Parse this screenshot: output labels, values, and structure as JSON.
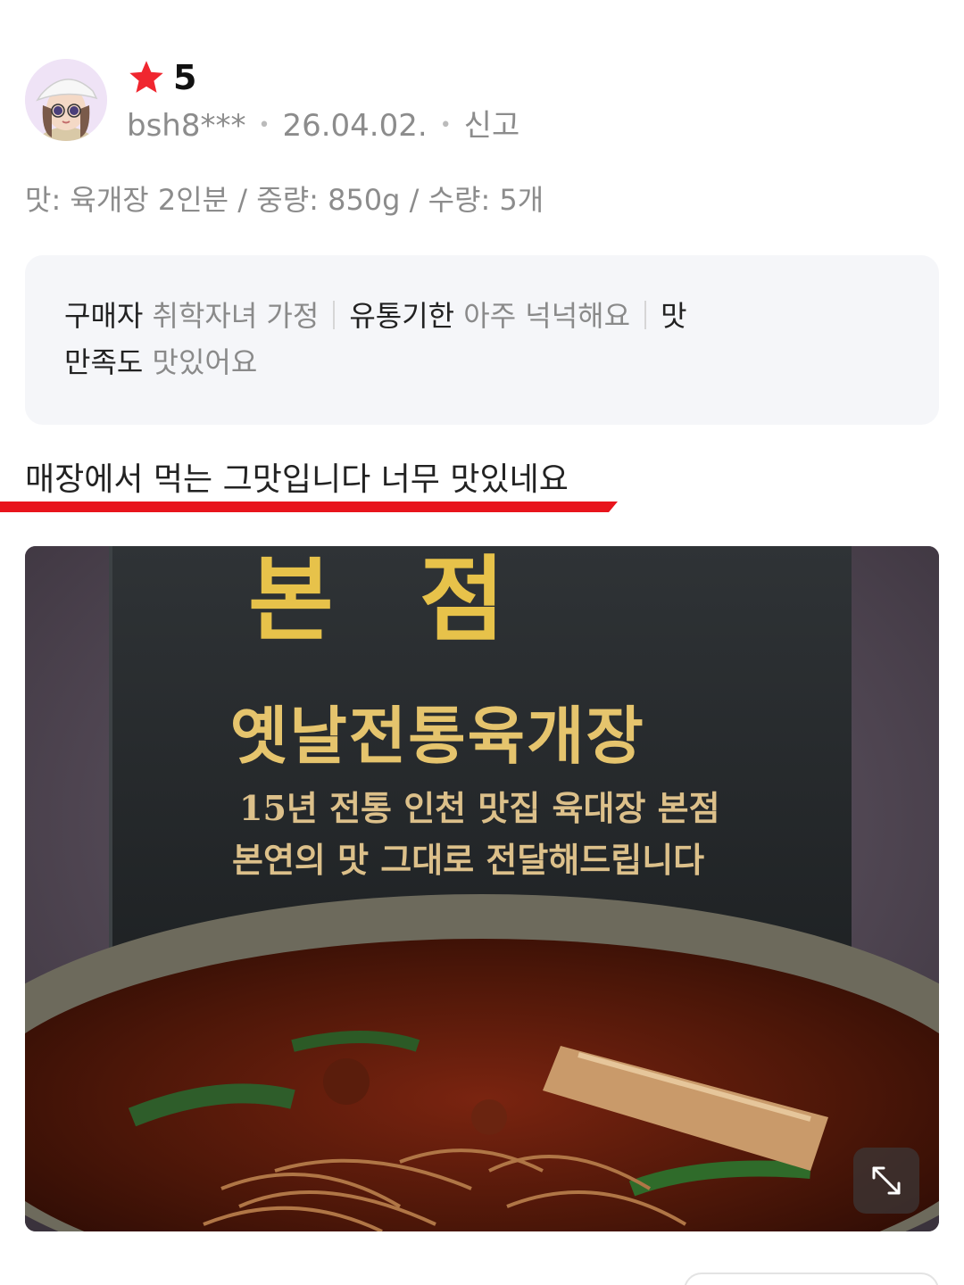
{
  "review": {
    "rating": "5",
    "author": "bsh8***",
    "date": "26.04.02.",
    "report_label": "신고",
    "option_text": "맛: 육개장 2인분 / 중량: 850g / 수량: 5개",
    "survey": [
      {
        "key": "구매자",
        "value": "취학자녀 가정"
      },
      {
        "key": "유통기한",
        "value": "아주 넉넉해요"
      },
      {
        "key": "맛",
        "value": ""
      },
      {
        "key": "만족도",
        "value": "맛있어요"
      }
    ],
    "text": "매장에서 먹는 그맛입니다 너무 맛있네요"
  },
  "photo": {
    "brand_text": "본 점",
    "product_name": "옛날전통육개장",
    "tagline_1": "15년 전통 인천 맛집 육대장 본점",
    "tagline_2": "본연의 맛 그대로 전달해드립니다"
  },
  "colors": {
    "star": "#f0262f",
    "underline": "#e8141c",
    "survey_bg": "#f5f6f9",
    "meta_text": "#8c8c8c"
  },
  "icons": {
    "star": "star-icon",
    "expand": "expand-icon",
    "avatar": "avatar"
  }
}
